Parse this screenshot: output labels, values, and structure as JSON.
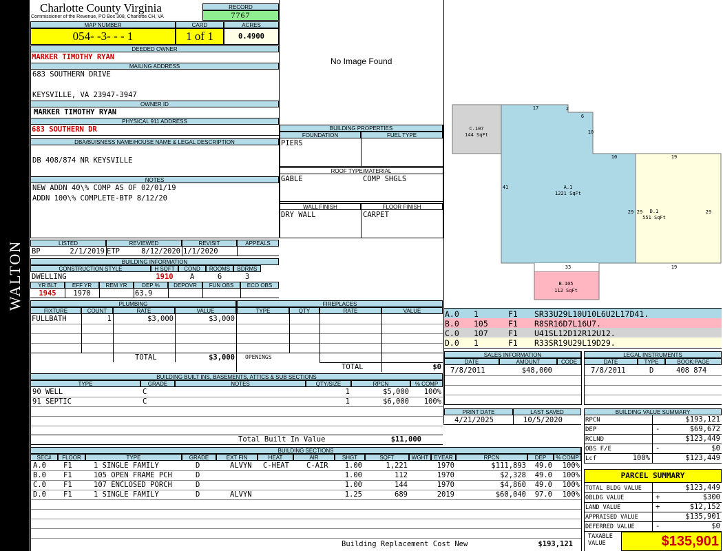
{
  "sidebar_label": "WALTON",
  "header": {
    "county": "Charlotte County Virginia",
    "commissioner": "Commissioner of the Revenue, PO Box 308, Charlotte CH, VA",
    "record_label": "RECORD",
    "record": "7767",
    "map_label": "MAP NUMBER",
    "map": "054- -3- - - 1",
    "card_label": "CARD",
    "card": "1 of 1",
    "acres_label": "ACRES",
    "acres": "0.4900"
  },
  "owner": {
    "deeded_label": "DEEDED OWNER",
    "deeded": "MARKER TIMOTHY RYAN",
    "mailing_label": "MAILING ADDRESS",
    "mail1": "683 SOUTHERN DRIVE",
    "mail2": "KEYSVILLE, VA 23947-3947",
    "ownerid_label": "OWNER ID",
    "owner_id_name": "MARKER TIMOTHY RYAN",
    "phys_label": "PHYSICAL 911 ADDRESS",
    "phys": "683 SOUTHERN DR",
    "dba_label": "DBA/BUISNESS NAME/HOUSE NAME & LEGAL DESCRIPTION",
    "legal": "DB 408/874 NR KEYSVILLE",
    "notes_label": "NOTES",
    "note1": "NEW ADDN 40\\% COMP AS OF 02/01/19",
    "note2": "ADDN 100\\% COMPLETE-BTP 8/12/20"
  },
  "image_text": "No Image Found",
  "props": {
    "title": "BUILDING PROPERTIES",
    "foundation_label": "FOUNDATION",
    "fuel_label": "FUEL TYPE",
    "foundation": "PIERS",
    "roof_label": "ROOF TYPE/MATERIAL",
    "roof_type": "GABLE",
    "roof_mat": "COMP SHGLS",
    "wall_label": "WALL FINISH",
    "floor_label": "FLOOR FINISH",
    "wall": "DRY WALL",
    "floor": "CARPET"
  },
  "listing": {
    "listed_label": "LISTED",
    "reviewed_label": "REVIEWED",
    "revisit_label": "REVISIT",
    "appeals_label": "APPEALS",
    "bp": "BP",
    "listed": "2/1/2019",
    "etp": "ETP",
    "reviewed": "8/12/2020",
    "revisit": "1/1/2020"
  },
  "bldg_info": {
    "title": "BUILDING INFORMATION",
    "cs_label": "CONSTRUCTION STYLE",
    "hsqft_label": "H SQFT",
    "cond_label": "COND",
    "rooms_label": "ROOMS",
    "bdrms_label": "BDRMS",
    "style": "DWELLING",
    "hsqft": "1910",
    "cond": "A",
    "rooms": "6",
    "bdrms": "3",
    "yrblt_label": "YR BLT",
    "effyr_label": "EFF YR",
    "remyr_label": "REM YR",
    "dep_label": "DEP %",
    "depovr_label": "DEPOVR",
    "funobs_label": "FUN OBS",
    "ecoobs_label": "ECO OBS",
    "yrblt": "1945",
    "effyr": "1970",
    "dep": "63.9"
  },
  "plumbing": {
    "title": "PLUMBING",
    "cols": [
      "FIXTURE",
      "COUNT",
      "RATE",
      "VALUE"
    ],
    "fixture": "FULLBATH",
    "count": "1",
    "rate": "$3,000",
    "value": "$3,000",
    "total_label": "TOTAL",
    "total": "$3,000"
  },
  "fireplaces": {
    "title": "FIREPLACES",
    "cols": [
      "TYPE",
      "QTY",
      "RATE",
      "VALUE"
    ],
    "openings": "OPENINGS",
    "total_label": "TOTAL",
    "total": "$0"
  },
  "builtins": {
    "title": "BUILDING BUILT INS, BASEMENTS, ATTICS & SUB SECTIONS",
    "cols": [
      "TYPE",
      "GRADE",
      "NOTES",
      "QTY/SIZE",
      "RPCN",
      "% COMP"
    ],
    "rows": [
      {
        "type": "90 WELL",
        "grade": "C",
        "qty": "1",
        "rpcn": "$5,000",
        "pct": "100%"
      },
      {
        "type": "91 SEPTIC",
        "grade": "C",
        "qty": "1",
        "rpcn": "$6,000",
        "pct": "100%"
      }
    ],
    "total_label": "Total Built In Value",
    "total": "$11,000"
  },
  "sections": {
    "title": "BUILDING SECTIONS",
    "cols": [
      "SEC#",
      "FLOOR",
      "TYPE",
      "GRADE",
      "EXT FIN",
      "HEAT",
      "AIR",
      "SHGT",
      "SQFT",
      "WGHT",
      "EYEAR",
      "RPCN",
      "DEP",
      "% COMP"
    ],
    "rows": [
      {
        "sec": "A.0",
        "floor": "F1",
        "type": "1 SINGLE FAMILY",
        "grade": "D",
        "ext": "ALVYN",
        "heat": "C-HEAT",
        "air": "C-AIR",
        "shgt": "1.00",
        "sqft": "1,221",
        "eyear": "1970",
        "rpcn": "$111,893",
        "dep": "49.0",
        "pct": "100%"
      },
      {
        "sec": "B.0",
        "floor": "F1",
        "type": "105 OPEN FRAME PCH",
        "grade": "D",
        "ext": "",
        "heat": "",
        "air": "",
        "shgt": "1.00",
        "sqft": "112",
        "eyear": "1970",
        "rpcn": "$2,328",
        "dep": "49.0",
        "pct": "100%"
      },
      {
        "sec": "C.0",
        "floor": "F1",
        "type": "107 ENCLOSED PORCH",
        "grade": "D",
        "ext": "",
        "heat": "",
        "air": "",
        "shgt": "1.00",
        "sqft": "144",
        "eyear": "1970",
        "rpcn": "$4,860",
        "dep": "49.0",
        "pct": "100%"
      },
      {
        "sec": "D.0",
        "floor": "F1",
        "type": "1 SINGLE FAMILY",
        "grade": "D",
        "ext": "ALVYN",
        "heat": "",
        "air": "",
        "shgt": "1.25",
        "sqft": "689",
        "eyear": "2019",
        "rpcn": "$60,040",
        "dep": "97.0",
        "pct": "100%"
      }
    ],
    "brcn_label": "Building Replacement Cost New",
    "brcn": "$193,121"
  },
  "sketch": {
    "c_label": "C.107",
    "c_area": "144 SqFt",
    "a_label": "A.1",
    "a_area": "1221 SqFt",
    "d_label": "D.1",
    "d_area": "551 SqFt",
    "b_label": "B.105",
    "b_area": "112 SqFt",
    "dims": {
      "d17": "17",
      "d2": "2",
      "d6": "6",
      "d10a": "10",
      "d10b": "10",
      "d19a": "19",
      "d41": "41",
      "d29a": "29",
      "d29b": "29",
      "d29c": "29",
      "d33": "33",
      "d19b": "19"
    }
  },
  "traces": [
    {
      "sec": "A.0",
      "n": "1",
      "fl": "F1",
      "code": "SR33U29L10U10L6U2L17D41.",
      "color": "#add8e6"
    },
    {
      "sec": "B.0",
      "n": "105",
      "fl": "F1",
      "code": "R8SR16D7L16U7.",
      "color": "#ffb6c1"
    },
    {
      "sec": "C.0",
      "n": "107",
      "fl": "F1",
      "code": "U41SL12D12R12U12.",
      "color": "#d3d3d3"
    },
    {
      "sec": "D.0",
      "n": "1",
      "fl": "F1",
      "code": "R33SR19U29L19D29.",
      "color": "#ffffe0"
    }
  ],
  "sales": {
    "title": "SALES INFORMATION",
    "cols": [
      "DATE",
      "AMOUNT",
      "CODE"
    ],
    "date": "7/8/2011",
    "amount": "$48,000"
  },
  "legal_inst": {
    "title": "LEGAL INSTRUMENTS",
    "cols": [
      "DATE",
      "TYPE",
      "BOOK:PAGE"
    ],
    "date": "7/8/2011",
    "type": "D",
    "bookpage": "408 874"
  },
  "dates": {
    "print_label": "PRINT DATE",
    "saved_label": "LAST SAVED",
    "print": "4/21/2025",
    "saved": "10/5/2020"
  },
  "bvs": {
    "title": "BUILDING VALUE SUMMARY",
    "rows": [
      {
        "label": "RPCN",
        "sign": "",
        "val": "$193,121"
      },
      {
        "label": "DEP",
        "sign": "-",
        "val": "$69,672"
      },
      {
        "label": "RCLND",
        "sign": "",
        "val": "$123,449"
      },
      {
        "label": "OBS F/E",
        "sign": "-",
        "val": "$0"
      },
      {
        "label": "Lcf",
        "pct": "100%",
        "sign": "",
        "val": "$123,449"
      }
    ]
  },
  "parcel": {
    "title": "PARCEL SUMMARY",
    "rows": [
      {
        "label": "TOTAL BLDG VALUE",
        "sign": "",
        "val": "$123,449"
      },
      {
        "label": "OBLDG VALUE",
        "sign": "+",
        "val": "$300"
      },
      {
        "label": "LAND VALUE",
        "sign": "+",
        "val": "$12,152"
      },
      {
        "label": "APPRAISED VALUE",
        "sign": "",
        "val": "$135,901"
      },
      {
        "label": "DEFERRED VALUE",
        "sign": "-",
        "val": "$0"
      }
    ],
    "taxable_label": "TAXABLE VALUE",
    "taxable": "$135,901"
  },
  "colors": {
    "header_blue": "#b4dce8",
    "yellow": "#ffff00",
    "record_green": "#90ee90",
    "red": "#cc0000"
  }
}
